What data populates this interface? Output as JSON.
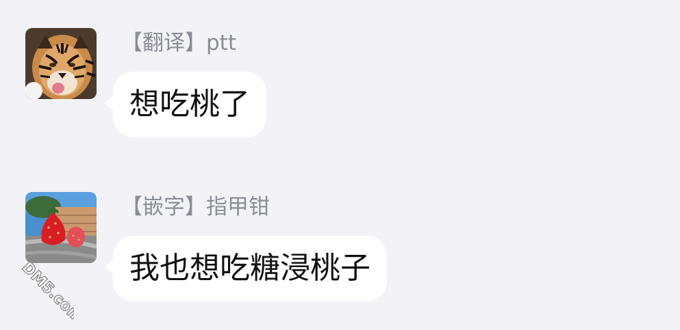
{
  "messages": [
    {
      "sender": "【翻译】ptt",
      "text": "想吃桃了",
      "avatar": "tiger-avatar"
    },
    {
      "sender": "【嵌字】指甲钳",
      "text": "我也想吃糖浸桃子",
      "avatar": "strawberry-avatar"
    }
  ],
  "watermark": {
    "text": "DM5.com"
  },
  "colors": {
    "background": "#f3f3f7",
    "bubble": "#ffffff",
    "sender_text": "#8a8d96",
    "message_text": "#111111"
  }
}
